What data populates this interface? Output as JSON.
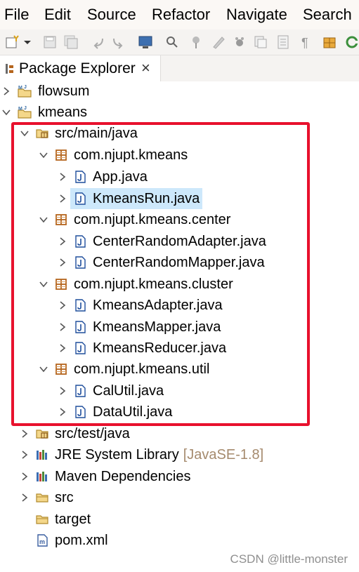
{
  "menubar": {
    "items": [
      "File",
      "Edit",
      "Source",
      "Refactor",
      "Navigate",
      "Search"
    ]
  },
  "toolbar": {
    "icons": [
      "new-wizard-icon",
      "dropdown-icon",
      "save-icon",
      "save-all-icon",
      "back-icon",
      "forward-icon",
      "terminal-icon",
      "search-icon",
      "pin-icon",
      "pen-icon",
      "debug-icon",
      "copy-icon",
      "document-icon",
      "pilcrow-icon",
      "package-icon",
      "refresh-icon"
    ]
  },
  "view": {
    "tab_title": "Package Explorer",
    "close_glyph": "×"
  },
  "tree": {
    "projects": [
      {
        "label": "flowsum"
      },
      {
        "label": "kmeans"
      }
    ],
    "src_main": "src/main/java",
    "packages": [
      {
        "label": "com.njupt.kmeans",
        "files": [
          "App.java",
          "KmeansRun.java"
        ]
      },
      {
        "label": "com.njupt.kmeans.center",
        "files": [
          "CenterRandomAdapter.java",
          "CenterRandomMapper.java"
        ]
      },
      {
        "label": "com.njupt.kmeans.cluster",
        "files": [
          "KmeansAdapter.java",
          "KmeansMapper.java",
          "KmeansReducer.java"
        ]
      },
      {
        "label": "com.njupt.kmeans.util",
        "files": [
          "CalUtil.java",
          "DataUtil.java"
        ]
      }
    ],
    "selected_file": "KmeansRun.java",
    "src_test": "src/test/java",
    "jre": {
      "label": "JRE System Library",
      "decoration": "[JavaSE-1.8]"
    },
    "maven": "Maven Dependencies",
    "src": "src",
    "target": "target",
    "pom": "pom.xml"
  },
  "watermark": "CSDN @little-monster",
  "colors": {
    "selection": "#cde8fb",
    "highlight_box": "#e8112d",
    "package_icon": "#b5651d",
    "folder_icon": "#c9a24a",
    "java_icon": "#1f4e9c"
  }
}
